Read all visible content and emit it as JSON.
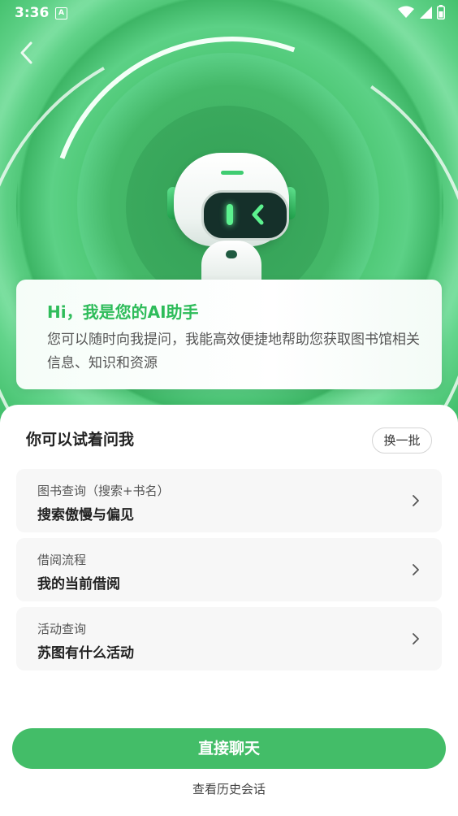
{
  "status_bar": {
    "time": "3:36",
    "notification_badge": "A",
    "icons": [
      "wifi-icon",
      "signal-icon",
      "battery-icon"
    ]
  },
  "nav": {
    "back_icon": "chevron-left-icon"
  },
  "intro": {
    "title": "Hi，我是您的AI助手",
    "description": "您可以随时向我提问，我能高效便捷地帮助您获取图书馆相关信息、知识和资源"
  },
  "suggestions": {
    "title": "你可以试着问我",
    "refresh_label": "换一批",
    "items": [
      {
        "category": "图书查询（搜索+书名）",
        "question": "搜索傲慢与偏见"
      },
      {
        "category": "借阅流程",
        "question": "我的当前借阅"
      },
      {
        "category": "活动查询",
        "question": "苏图有什么活动"
      }
    ]
  },
  "actions": {
    "chat_label": "直接聊天",
    "history_label": "查看历史会话"
  },
  "colors": {
    "accent": "#43bd68",
    "title_green": "#2ebc5a"
  }
}
